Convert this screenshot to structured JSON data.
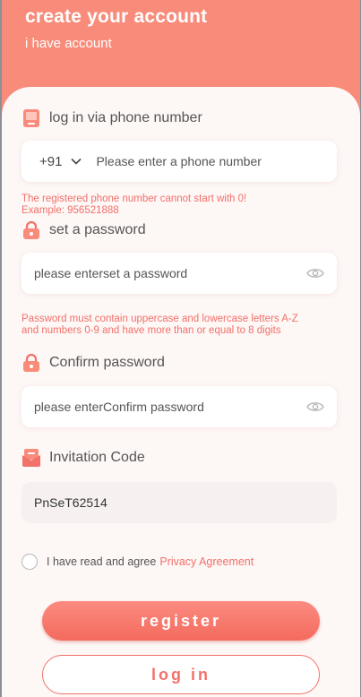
{
  "header": {
    "title": "create your account",
    "have_account_link": "i have account"
  },
  "phone": {
    "label": "log in via phone number",
    "country_code": "+91",
    "placeholder": "Please enter a phone number",
    "hint_line1": "The registered phone number cannot start with 0!",
    "hint_line2": "Example: 956521888"
  },
  "password": {
    "label": "set a password",
    "placeholder": "please enterset a password",
    "hint": "Password must contain uppercase and lowercase letters A-Z and numbers 0-9 and have more than or equal to 8 digits"
  },
  "confirm": {
    "label": "Confirm password",
    "placeholder": "please enterConfirm password"
  },
  "invite": {
    "label": "Invitation Code",
    "value": "PnSeT62514"
  },
  "agreement": {
    "text": "I have read and agree",
    "link": "Privacy Agreement"
  },
  "buttons": {
    "register": "register",
    "login": "log in"
  },
  "colors": {
    "accent": "#f98b7a",
    "error": "#f2716a"
  },
  "icons": {
    "phone": "phone-icon",
    "lock": "lock-icon",
    "eye": "eye-icon",
    "chevron": "chevron-down-icon",
    "invite": "invitation-icon"
  }
}
